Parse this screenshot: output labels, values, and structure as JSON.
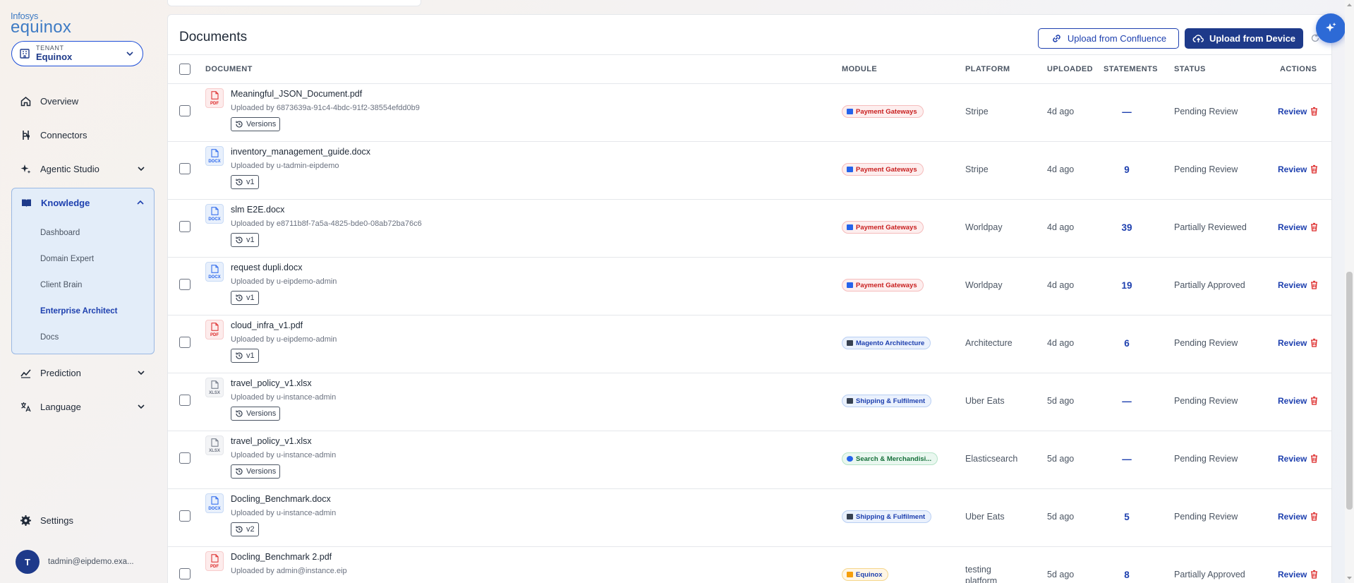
{
  "brand": {
    "top": "Infosys",
    "bottom": "equinox",
    "color": "#3e7bc4"
  },
  "tenant": {
    "label": "TENANT",
    "name": "Equinox"
  },
  "nav": {
    "overview": "Overview",
    "connectors": "Connectors",
    "agentic_studio": "Agentic Studio",
    "knowledge": "Knowledge",
    "knowledge_items": [
      "Dashboard",
      "Domain Expert",
      "Client Brain",
      "Enterprise Architect",
      "Docs"
    ],
    "active_subitem": "Enterprise Architect",
    "prediction": "Prediction",
    "language": "Language",
    "settings": "Settings"
  },
  "user": {
    "initial": "T",
    "email": "tadmin@eipdemo.exa..."
  },
  "documents": {
    "title": "Documents",
    "upload_confluence": "Upload from Confluence",
    "upload_device": "Upload from Device",
    "columns": {
      "document": "DOCUMENT",
      "module": "MODULE",
      "platform": "PLATFORM",
      "uploaded": "UPLOADED",
      "statements": "STATEMENTS",
      "status": "STATUS",
      "actions": "ACTIONS"
    },
    "review_label": "Review",
    "rows": [
      {
        "type": "PDF",
        "name": "Meaningful_JSON_Document.pdf",
        "uploader": "Uploaded by 6873639a-91c4-4bdc-91f2-38554efdd0b9",
        "version": "Versions",
        "module": "Payment Gateways",
        "module_style": "red",
        "platform": "Stripe",
        "uploaded": "4d ago",
        "statements": "—",
        "status": "Pending Review"
      },
      {
        "type": "DOCX",
        "name": "inventory_management_guide.docx",
        "uploader": "Uploaded by u-tadmin-eipdemo",
        "version": "v1",
        "module": "Payment Gateways",
        "module_style": "red",
        "platform": "Stripe",
        "uploaded": "4d ago",
        "statements": "9",
        "status": "Pending Review"
      },
      {
        "type": "DOCX",
        "name": "slm E2E.docx",
        "uploader": "Uploaded by e8711b8f-7a5a-4825-bde0-08ab72ba76c6",
        "version": "v1",
        "module": "Payment Gateways",
        "module_style": "red",
        "platform": "Worldpay",
        "uploaded": "4d ago",
        "statements": "39",
        "status": "Partially Reviewed"
      },
      {
        "type": "DOCX",
        "name": "request dupli.docx",
        "uploader": "Uploaded by u-eipdemo-admin",
        "version": "v1",
        "module": "Payment Gateways",
        "module_style": "red",
        "platform": "Worldpay",
        "uploaded": "4d ago",
        "statements": "19",
        "status": "Partially Approved"
      },
      {
        "type": "PDF",
        "name": "cloud_infra_v1.pdf",
        "uploader": "Uploaded by u-eipdemo-admin",
        "version": "v1",
        "module": "Magento Architecture",
        "module_style": "blue",
        "platform": "Architecture",
        "uploaded": "4d ago",
        "statements": "6",
        "status": "Pending Review"
      },
      {
        "type": "XLSX",
        "name": "travel_policy_v1.xlsx",
        "uploader": "Uploaded by u-instance-admin",
        "version": "Versions",
        "module": "Shipping & Fulfilment",
        "module_style": "blue",
        "platform": "Uber Eats",
        "uploaded": "5d ago",
        "statements": "—",
        "status": "Pending Review"
      },
      {
        "type": "XLSX",
        "name": "travel_policy_v1.xlsx",
        "uploader": "Uploaded by u-instance-admin",
        "version": "Versions",
        "module": "Search & Merchandisi...",
        "module_style": "green",
        "platform": "Elasticsearch",
        "uploaded": "5d ago",
        "statements": "—",
        "status": "Pending Review"
      },
      {
        "type": "DOCX",
        "name": "Docling_Benchmark.docx",
        "uploader": "Uploaded by u-instance-admin",
        "version": "v2",
        "module": "Shipping & Fulfilment",
        "module_style": "blue",
        "platform": "Uber Eats",
        "uploaded": "5d ago",
        "statements": "5",
        "status": "Pending Review"
      },
      {
        "type": "PDF",
        "name": "Docling_Benchmark 2.pdf",
        "uploader": "Uploaded by admin@instance.eip",
        "version": "",
        "module": "Equinox",
        "module_style": "amber",
        "platform": "testing platform",
        "uploaded": "5d ago",
        "statements": "8",
        "status": "Partially Approved"
      }
    ]
  },
  "colors": {
    "primary": "#1e3a8a",
    "accent": "#1e40af",
    "danger": "#dc2626"
  },
  "icons": [
    "home-icon",
    "connectors-icon",
    "sparkle-icon",
    "book-icon",
    "prediction-icon",
    "language-icon",
    "gear-icon",
    "building-icon",
    "chevron-down-icon",
    "link-icon",
    "cloud-upload-icon",
    "history-icon",
    "trash-icon",
    "file-icon",
    "ai-sparkle-icon"
  ]
}
